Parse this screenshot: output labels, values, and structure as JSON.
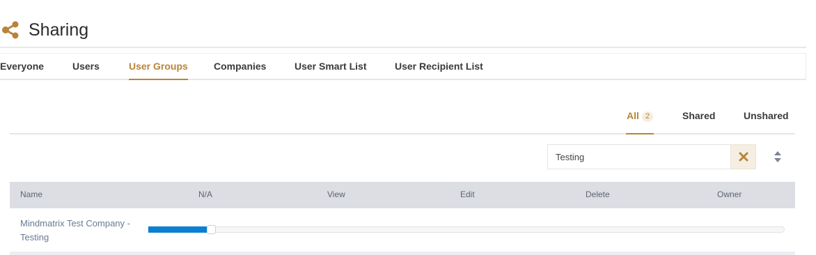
{
  "header": {
    "title": "Sharing",
    "icon": "share-icon",
    "accent_color": "#b8843a"
  },
  "tabs": [
    {
      "label": "Everyone",
      "active": false
    },
    {
      "label": "Users",
      "active": false
    },
    {
      "label": "User Groups",
      "active": true
    },
    {
      "label": "Companies",
      "active": false
    },
    {
      "label": "User Smart List",
      "active": false
    },
    {
      "label": "User Recipient List",
      "active": false
    }
  ],
  "filter_tabs": {
    "all": {
      "label": "All",
      "count": "2"
    },
    "shared": {
      "label": "Shared"
    },
    "unshared": {
      "label": "Unshared"
    }
  },
  "search": {
    "value": "Testing",
    "clear_icon": "close-icon",
    "sort_icon": "sort-icon"
  },
  "table": {
    "columns": [
      "Name",
      "N/A",
      "View",
      "Edit",
      "Delete",
      "Owner"
    ],
    "rows": [
      {
        "name": "Mindmatrix Test Company - Testing",
        "permission_level": 0.1,
        "slider_color": "#0b7fd1"
      }
    ]
  }
}
